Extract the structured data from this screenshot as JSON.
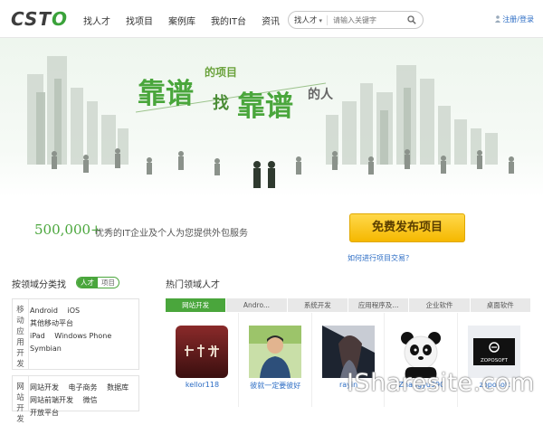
{
  "header": {
    "logo": {
      "before": "CST",
      "o": "O"
    },
    "nav": [
      "找人才",
      "找项目",
      "案例库",
      "我的IT台",
      "资讯"
    ],
    "search": {
      "scope": "找人才",
      "placeholder": "请输入关键字"
    },
    "user": {
      "register": "注册",
      "sep": "/",
      "login": "登录"
    }
  },
  "banner": {
    "slogan_main_1": "靠谱",
    "slogan_small_1": "的项目",
    "slogan_find": "找",
    "slogan_main_2": "靠谱",
    "slogan_small_2": "的人"
  },
  "stats": {
    "count": "500,000+",
    "description": "优秀的IT企业及个人为您提供外包服务",
    "cta": "免费发布项目",
    "howto": "如何进行项目交易？"
  },
  "left": {
    "title": "按领域分类找",
    "toggle": {
      "active": "人才",
      "inactive": "项目"
    },
    "groups": [
      {
        "side": "移动应用开发",
        "items": [
          "Android",
          "iOS",
          "其他移动平台",
          "iPad",
          "Windows Phone",
          "Symbian"
        ]
      },
      {
        "side": "网站开发",
        "items": [
          "网站开发",
          "电子商务",
          "数据库",
          "网站前端开发",
          "微信",
          "开放平台"
        ]
      }
    ]
  },
  "hot": {
    "title": "热门领域人才",
    "tabs": [
      "网站开发",
      "Andro...",
      "系统开发",
      "应用程序及...",
      "企业软件",
      "桌面软件"
    ],
    "cards": [
      {
        "name": "kellor118",
        "avatar": "calligraphy"
      },
      {
        "name": "彼就一定要彼好",
        "avatar": "person"
      },
      {
        "name": "rayin",
        "avatar": "anime"
      },
      {
        "name": "Zhangyu990",
        "avatar": "panda"
      },
      {
        "name": "zoposoft",
        "avatar": "logo",
        "logo_text": "ZOPOSOFT"
      }
    ]
  },
  "watermark": "ISharesite.com",
  "colors": {
    "brand_green": "#4aa63c",
    "link_blue": "#2b6cc4",
    "cta_yellow": "#f5b800"
  }
}
